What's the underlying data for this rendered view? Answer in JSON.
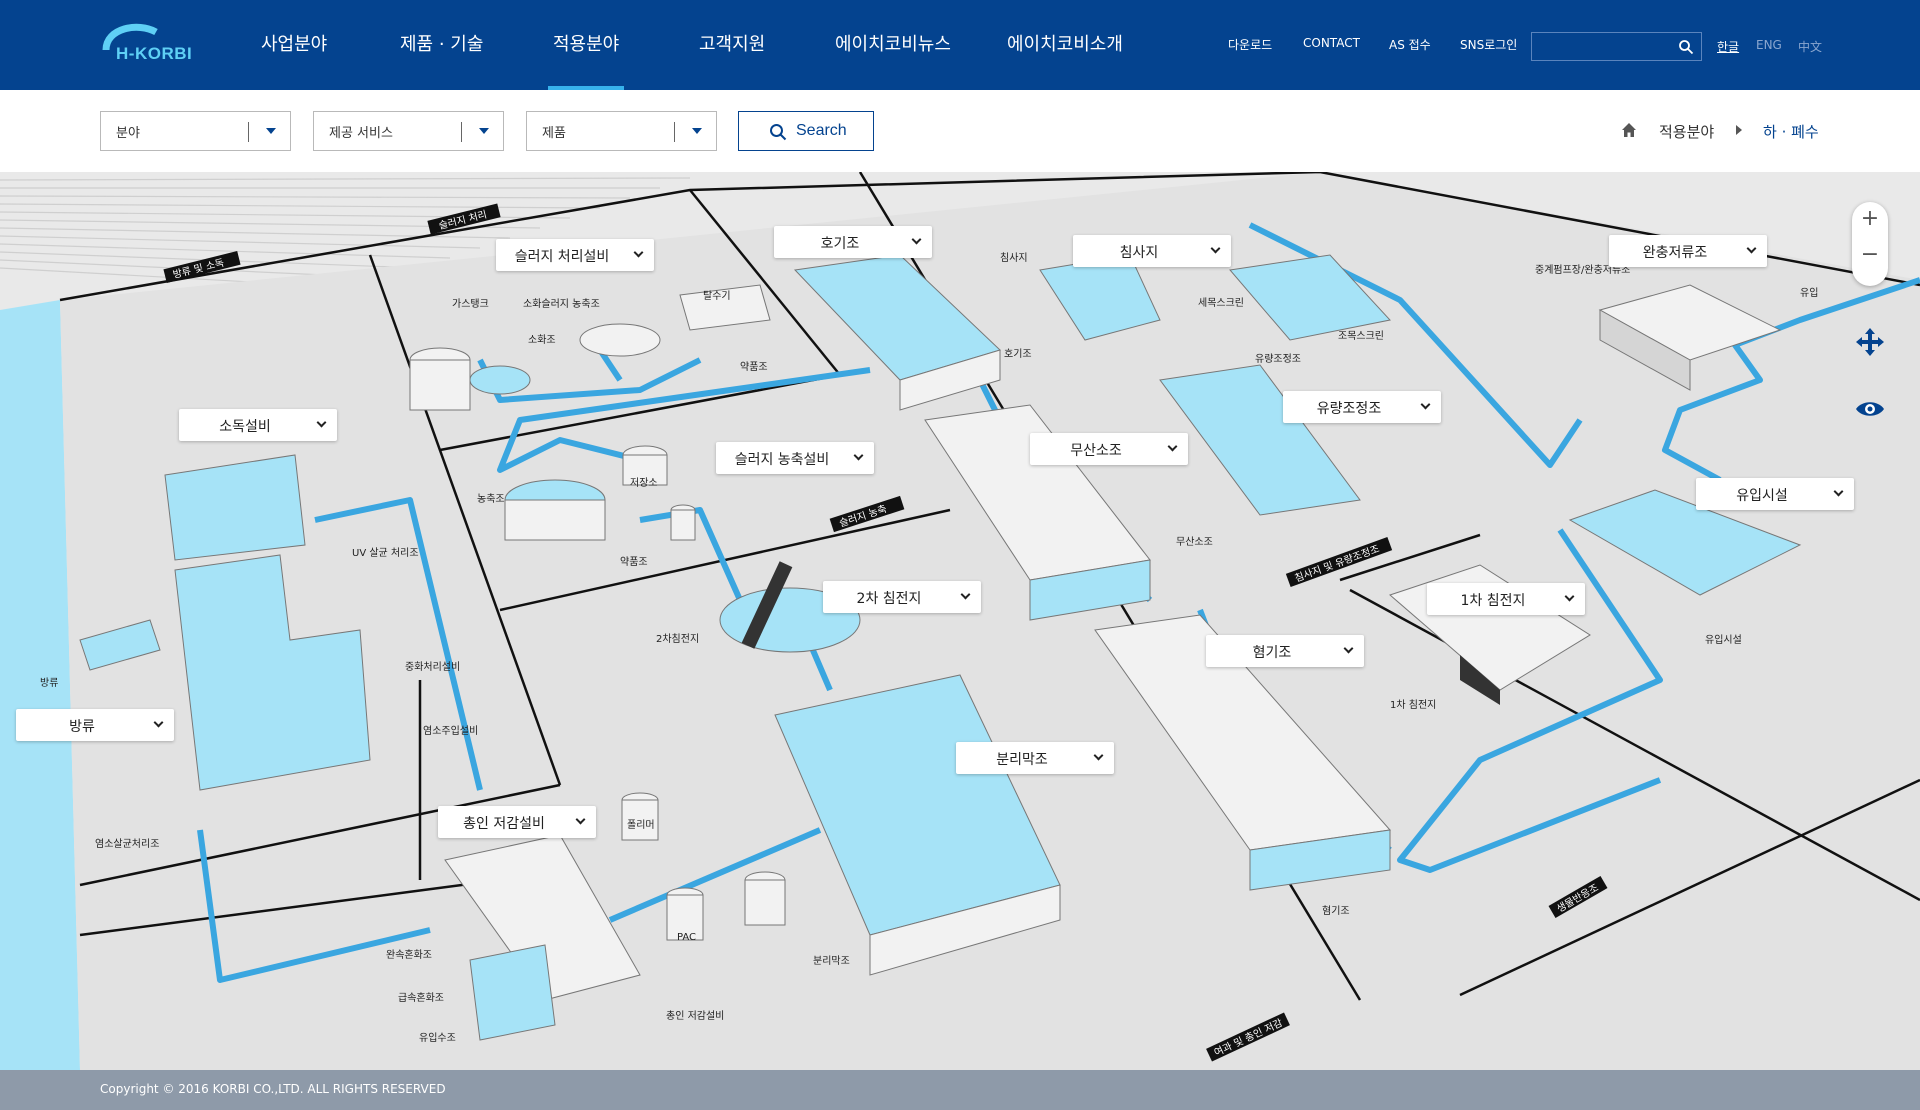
{
  "header": {
    "logo_text": "H-KORBI",
    "nav": [
      "사업분야",
      "제품 · 기술",
      "적용분야",
      "고객지원",
      "에이치코비뉴스",
      "에이치코비소개"
    ],
    "active_nav_index": 2,
    "utility": [
      "다운로드",
      "CONTACT",
      "AS 접수",
      "SNS로그인"
    ],
    "search_value": "",
    "languages": [
      "한글",
      "ENG",
      "中文"
    ],
    "active_language": "한글"
  },
  "filters": {
    "field": "분야",
    "service": "제공 서비스",
    "product": "제품",
    "search_label": "Search"
  },
  "breadcrumb": {
    "level1": "적용분야",
    "level2": "하 · 폐수"
  },
  "map": {
    "popups": [
      "슬러지 처리설비",
      "호기조",
      "침사지",
      "완충저류조",
      "소독설비",
      "슬러지 농축설비",
      "무산소조",
      "유량조정조",
      "유입시설",
      "2차 침전지",
      "1차 침전지",
      "혐기조",
      "방류",
      "분리막조",
      "총인 저감설비"
    ],
    "zone_labels": [
      "슬러지 처리",
      "방류 및 소독",
      "슬러지 농축",
      "침사지 및 유량조정조",
      "생물반응조",
      "여과 및 총인 저감"
    ],
    "callouts": [
      "가스탱크",
      "소화슬러지 농축조",
      "소화조",
      "탈수기",
      "약품조",
      "농축조",
      "저장소",
      "약품조",
      "UV 살균 처리조",
      "중화처리설비",
      "염소주입설비",
      "염소살균처리조",
      "방류",
      "2차침전지",
      "폴리머",
      "PAC",
      "완속혼화조",
      "급속혼화조",
      "유입수조",
      "총인 저감설비",
      "분리막조",
      "호기조",
      "침사지",
      "세목스크린",
      "조목스크린",
      "유량조정조",
      "무산소조",
      "혐기조",
      "1차 침전지",
      "중계펌프장/완충저류조",
      "유입",
      "유입시설"
    ]
  },
  "map_controls": {
    "zoom_in": "+",
    "zoom_out": "−"
  },
  "footer": {
    "copyright": "Copyright © 2016 KORBI CO.,LTD. ALL RIGHTS RESERVED"
  },
  "colors": {
    "brand": "#04438f",
    "accent": "#37b2ec",
    "water": "#a6e3f7",
    "pipe": "#3aa6e0",
    "footer": "#8e9aa9"
  }
}
